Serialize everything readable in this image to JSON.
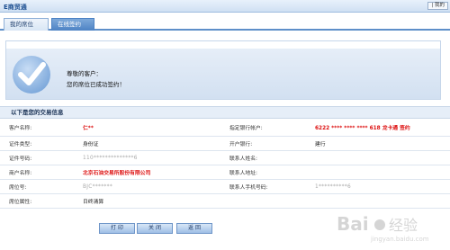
{
  "header": {
    "brand": "E商贸通",
    "top_link": "| 我的"
  },
  "tabs": [
    {
      "label": "我的席位",
      "active": false
    },
    {
      "label": "在线签约",
      "active": true
    }
  ],
  "success": {
    "greeting": "尊敬的客户：",
    "message": "您的席位已成功签约！",
    "icon": "checkmark-icon"
  },
  "info": {
    "title": "以下是您的交易信息",
    "rows": [
      {
        "l1": "客户名称:",
        "v1": "仁**",
        "l2": "指定银行帐户:",
        "v2": "6222 **** **** **** 618 龙卡通 签约"
      },
      {
        "l1": "证件类型:",
        "v1": "身份证",
        "l2": "开户银行:",
        "v2": "建行"
      },
      {
        "l1": "证件号码:",
        "v1": "110**************6",
        "l2": "联系人姓名:",
        "v2": ""
      },
      {
        "l1": "商户名称:",
        "v1": "北京石油交易所股份有限公司",
        "l2": "联系人地址:",
        "v2": ""
      },
      {
        "l1": "席位号:",
        "v1": "BJC*******",
        "l2": "联系人手机号码:",
        "v2": "1**********6"
      },
      {
        "l1": "席位属性:",
        "v1": "日终清算",
        "l2": "",
        "v2": ""
      }
    ]
  },
  "buttons": {
    "print": "打 印",
    "close": "关 闭",
    "back": "返 回"
  },
  "watermark": {
    "text": "Bai 经验",
    "subtext": "jingyan.baidu.com"
  },
  "colors": {
    "accent": "#4d82c4",
    "highlight": "#d11111"
  }
}
